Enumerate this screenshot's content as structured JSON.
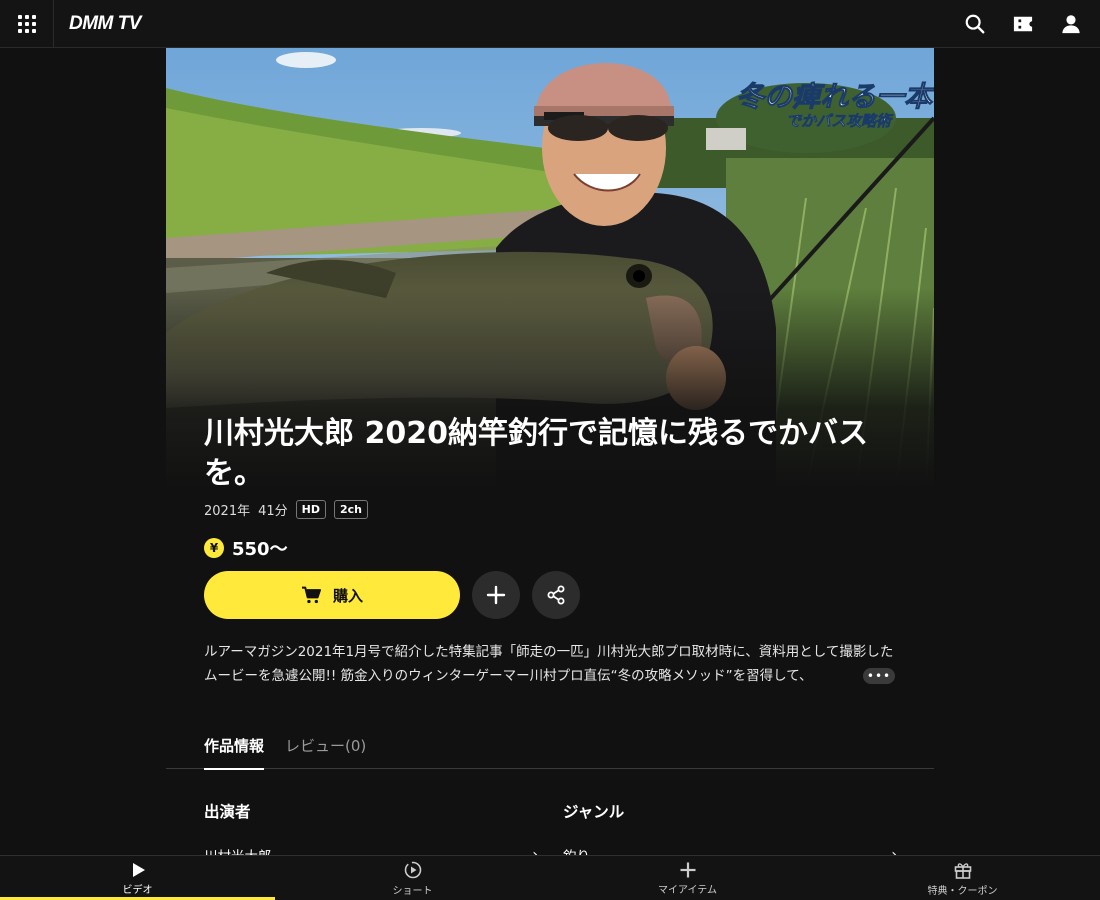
{
  "header": {
    "logo": "DMM TV",
    "icons": [
      "grid-menu-icon",
      "search-icon",
      "ticket-icon",
      "user-icon"
    ]
  },
  "hero": {
    "overlay_text_line1": "冬の痺れる一本",
    "overlay_text_line2": "でかバス攻略術"
  },
  "title": "川村光大郎 2020納竿釣行で記憶に残るでかバスを。",
  "meta": {
    "year": "2021年",
    "duration": "41分",
    "badges": [
      "HD",
      "2ch"
    ]
  },
  "price": {
    "currency_icon": "¥",
    "text": "550〜"
  },
  "actions": {
    "buy_label": "購入",
    "add_icon": "plus-icon",
    "share_icon": "share-icon"
  },
  "description": "ルアーマガジン2021年1月号で紹介した特集記事「師走の一匹」川村光大郎プロ取材時に、資料用として撮影したムービーを急遽公開!! 筋金入りのウィンターゲーマー川村プロ直伝“冬の攻略メソッド”を習得して、",
  "more_label": "•••",
  "tabs": {
    "info": "作品情報",
    "review": "レビュー(0)"
  },
  "info": {
    "cast_heading": "出演者",
    "cast_value": "川村光大郎",
    "genre_heading": "ジャンル",
    "genre_value": "釣り"
  },
  "bottom_nav": [
    {
      "label": "ビデオ",
      "icon": "play-icon"
    },
    {
      "label": "ショート",
      "icon": "short-icon"
    },
    {
      "label": "マイアイテム",
      "icon": "plus-icon"
    },
    {
      "label": "特典・クーポン",
      "icon": "gift-icon"
    }
  ],
  "colors": {
    "accent": "#ffe93b",
    "background": "#111111"
  }
}
